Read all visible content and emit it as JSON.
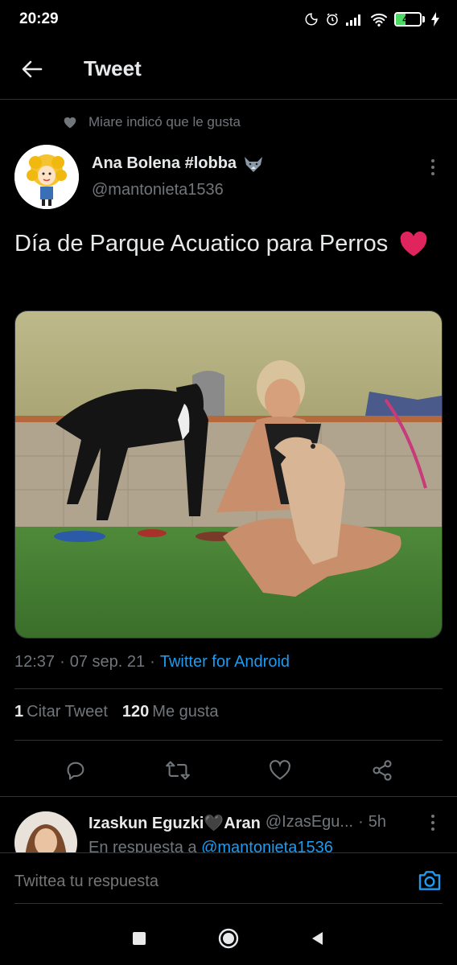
{
  "status_bar": {
    "time": "20:29",
    "battery": "40",
    "icons": [
      "moon-icon",
      "alarm-icon",
      "signal-icon",
      "wifi-icon",
      "battery-icon",
      "charging-icon"
    ]
  },
  "header": {
    "title": "Tweet",
    "back_icon": "arrow-left-icon"
  },
  "social_context": {
    "text": "Miare indicó que le gusta",
    "icon": "heart-icon"
  },
  "tweet": {
    "author_name": "Ana Bolena #lobba",
    "author_emoji": "wolf-icon",
    "author_handle": "@mantonieta1536",
    "text": "Día de Parque Acuatico para Perros",
    "text_emoji": "red-heart-icon",
    "meta_time": "12:37",
    "meta_sep1": "·",
    "meta_date": "07 sep. 21",
    "meta_sep2": "·",
    "meta_source": "Twitter for Android"
  },
  "stats": {
    "quotes_count": "1",
    "quotes_label": "Citar Tweet",
    "likes_count": "120",
    "likes_label": "Me gusta"
  },
  "actions": [
    "reply-icon",
    "retweet-icon",
    "like-icon",
    "share-icon"
  ],
  "reply": {
    "name": "Izaskun Eguzki🖤Aran",
    "handle": "@IzasEgu...",
    "sep": "·",
    "time": "5h",
    "reply_prefix": "En respuesta a",
    "reply_mention": "@mantonieta1536"
  },
  "compose": {
    "placeholder": "Twittea tu respuesta",
    "icon": "camera-icon"
  },
  "nav": [
    "recents-icon",
    "home-icon",
    "back-icon"
  ],
  "colors": {
    "accent": "#1d9bf0",
    "background": "#000000",
    "secondary_text": "#71767b",
    "divider": "#2f3336"
  }
}
